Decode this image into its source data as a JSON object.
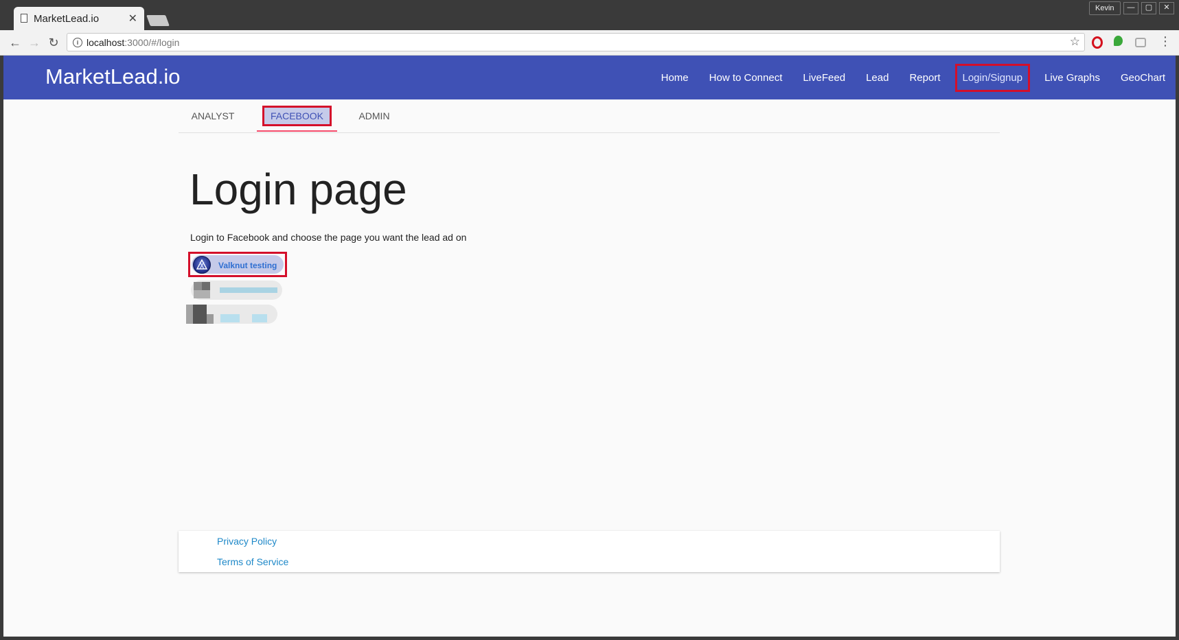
{
  "browser": {
    "tab_title": "MarketLead.io",
    "tab_close_glyph": "✕",
    "user_name": "Kevin",
    "url_host": "localhost",
    "url_path": ":3000/#/login",
    "window_controls": {
      "minimize": "—",
      "maximize": "▢",
      "close": "✕"
    },
    "nav": {
      "back": "←",
      "forward": "→",
      "reload": "↻"
    },
    "icons": [
      "page-icon",
      "info-icon",
      "star-icon",
      "opera-icon",
      "ghostery-icon",
      "incognito-icon",
      "menu-icon"
    ],
    "star_glyph": "☆",
    "menu_glyph": "⋮",
    "info_glyph": "i"
  },
  "header": {
    "brand": "MarketLead.io",
    "nav": [
      {
        "label": "Home"
      },
      {
        "label": "How to Connect"
      },
      {
        "label": "LiveFeed"
      },
      {
        "label": "Lead"
      },
      {
        "label": "Report"
      },
      {
        "label": "Login/Signup",
        "active": true
      },
      {
        "label": "Live Graphs"
      },
      {
        "label": "GeoChart"
      }
    ]
  },
  "tabs": [
    {
      "label": "ANALYST"
    },
    {
      "label": "FACEBOOK",
      "active": true
    },
    {
      "label": "ADMIN"
    }
  ],
  "main": {
    "title": "Login page",
    "instructions": "Login to Facebook and choose the page you want the lead ad on",
    "pages": [
      {
        "label": "Valknut testing"
      }
    ]
  },
  "footer": {
    "links": [
      {
        "label": "Privacy Policy"
      },
      {
        "label": "Terms of Service"
      }
    ]
  },
  "colors": {
    "appbar": "#3f51b5",
    "highlight_box": "#d40f2a",
    "tab_ink": "#f44a6a",
    "link": "#1e88c8"
  }
}
